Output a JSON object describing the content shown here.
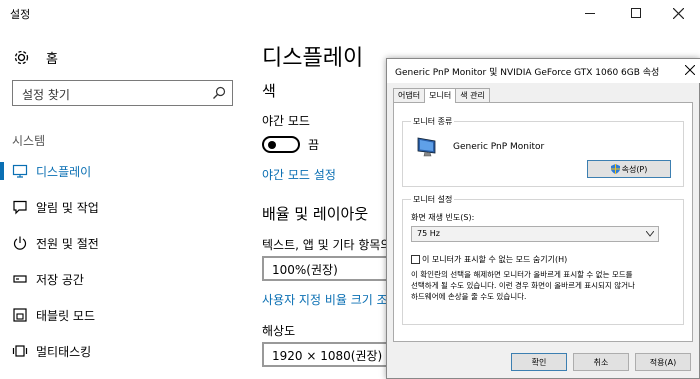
{
  "window": {
    "title": "설정"
  },
  "sidebar": {
    "home_label": "홈",
    "search_placeholder": "설정 찾기",
    "section": "시스템",
    "items": [
      {
        "label": "디스플레이",
        "icon": "monitor-icon",
        "active": true
      },
      {
        "label": "알림 및 작업",
        "icon": "notification-icon"
      },
      {
        "label": "전원 및 절전",
        "icon": "power-icon"
      },
      {
        "label": "저장 공간",
        "icon": "storage-icon"
      },
      {
        "label": "태블릿 모드",
        "icon": "tablet-icon"
      },
      {
        "label": "멀티태스킹",
        "icon": "multitask-icon"
      }
    ]
  },
  "main": {
    "title": "디스플레이",
    "color_heading": "색",
    "night_mode_label": "야간 모드",
    "night_mode_state": "끔",
    "night_mode_settings_link": "야간 모드 설정",
    "layout_heading": "배율 및 레이아웃",
    "scale_label": "텍스트, 앱 및 기타 항목의",
    "scale_value": "100%(권장)",
    "custom_scale_link": "사용자 지정 비율 크기 조",
    "resolution_label": "해상도",
    "resolution_value": "1920 × 1080(권장)"
  },
  "dialog": {
    "title": "Generic PnP Monitor 및 NVIDIA GeForce GTX 1060 6GB 속성",
    "tabs": [
      "어댑터",
      "모니터",
      "색 관리"
    ],
    "active_tab": "모니터",
    "monitor_type_group": "모니터 종류",
    "monitor_name": "Generic PnP Monitor",
    "properties_button": "속성(P)",
    "monitor_settings_group": "모니터 설정",
    "refresh_rate_label": "화면 재생 빈도(S):",
    "refresh_rate_value": "75 Hz",
    "hide_modes_label": "이 모니터가 표시할 수 없는 모드 숨기기(H)",
    "hide_modes_checked": false,
    "warning_lines": [
      "이 확인란의 선택을 해제하면 모니터가 올바르게 표시할 수 없는 모드를",
      "선택하게 될 수도 있습니다. 이런 경우 화면이 올바르게 표시되지 않거나",
      "하드웨어에 손상을 줄 수도 있습니다."
    ],
    "ok_button": "확인",
    "cancel_button": "취소",
    "apply_button": "적용(A)"
  },
  "colors": {
    "accent": "#0a6fb3"
  }
}
